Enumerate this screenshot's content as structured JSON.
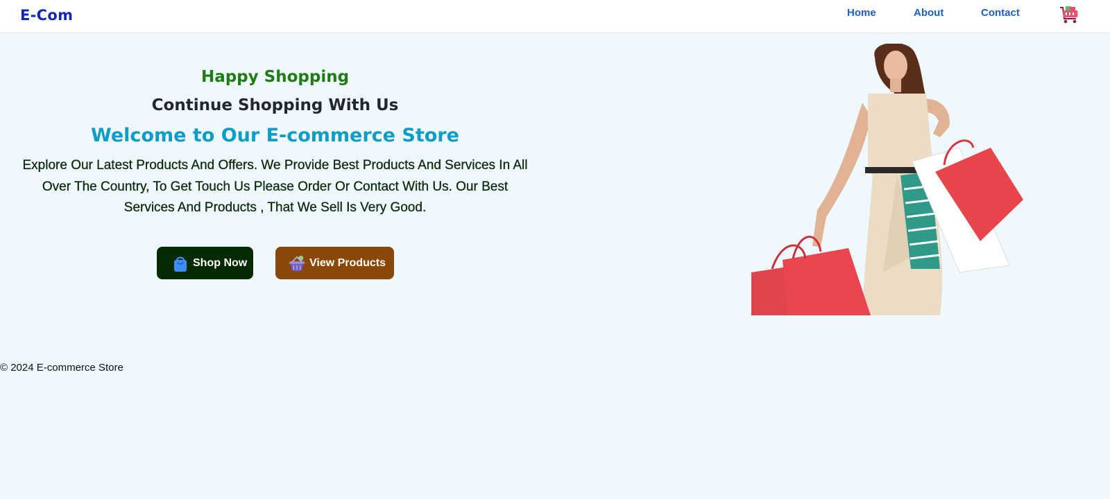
{
  "navbar": {
    "brand": "E-Com",
    "links": [
      "Home",
      "About",
      "Contact"
    ],
    "cart_icon": "shopping-cart-icon"
  },
  "hero": {
    "tagline": "Happy Shopping",
    "subtitle": "Continue Shopping With Us",
    "title": "Welcome to Our E-commerce Store",
    "description": "Explore Our Latest Products And Offers. We Provide Best Products And Services In All Over The Country, To Get Touch Us Please Order Or Contact With Us. Our Best Services And Products , That We Sell Is Very Good.",
    "buttons": {
      "shop_now": "Shop Now",
      "view_products": "View Products"
    },
    "image": "woman-with-shopping-bags"
  },
  "footer": {
    "copyright": "© 2024 E-commerce Store"
  },
  "colors": {
    "background": "#eff8fd",
    "brand": "#1426b8",
    "nav_link": "#1a5fc6",
    "tagline": "#1d7d13",
    "title": "#0e9cc8",
    "shop_button": "#062a04",
    "view_button": "#8a4708"
  }
}
